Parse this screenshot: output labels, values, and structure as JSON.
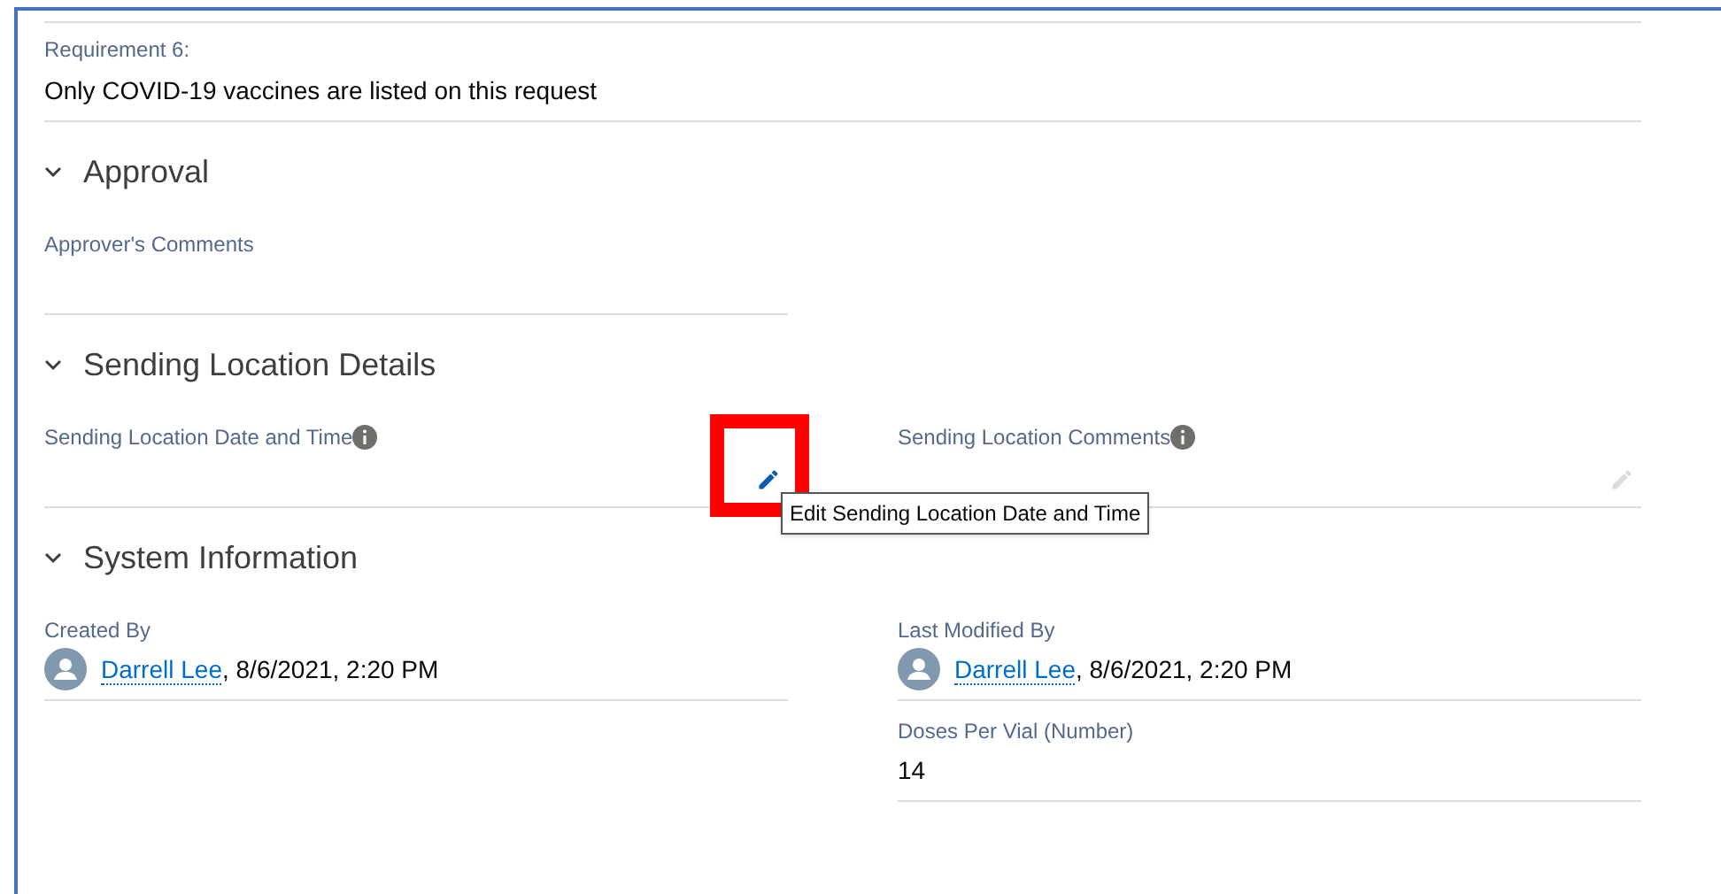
{
  "requirement": {
    "label": "Requirement 6:",
    "value": "Only COVID-19 vaccines are listed on this request"
  },
  "sections": [
    {
      "title": "Approval",
      "expanded": true,
      "rows": [
        {
          "left": {
            "label": "Approver's Comments"
          }
        }
      ]
    },
    {
      "title": "Sending Location Details",
      "expanded": true,
      "rows": [
        {
          "left": {
            "label": "Sending Location Date and Time",
            "info": true,
            "editable": true,
            "edit_hovered": true,
            "tooltip": "Edit Sending Location Date and Time"
          },
          "right": {
            "label": "Sending Location Comments",
            "info": true,
            "editable": true,
            "edit_hovered": false
          }
        }
      ]
    },
    {
      "title": "System Information",
      "expanded": true,
      "rows": [
        {
          "left": {
            "label": "Created By",
            "user": "Darrell Lee",
            "value": ", 8/6/2021, 2:20 PM"
          },
          "right": {
            "label": "Last Modified By",
            "user": "Darrell Lee",
            "value": ", 8/6/2021, 2:20 PM"
          }
        },
        {
          "right": {
            "label": "Doses Per Vial (Number)",
            "value": "14"
          }
        }
      ]
    }
  ]
}
